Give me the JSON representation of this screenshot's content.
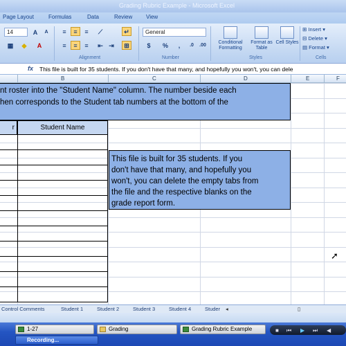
{
  "window": {
    "title": "Grading Rubric Example - Microsoft Excel"
  },
  "ribbon_tabs": [
    "Page Layout",
    "Formulas",
    "Data",
    "Review",
    "View"
  ],
  "ribbon": {
    "font_size": "14",
    "number_format": "General",
    "group_alignment": "Alignment",
    "group_number": "Number",
    "group_styles": "Styles",
    "group_cells": "Cells",
    "conditional_formatting": "Conditional Formatting",
    "format_as_table": "Format as Table",
    "cell_styles": "Cell Styles",
    "insert_label": "Insert",
    "delete_label": "Delete",
    "format_label": "Format",
    "currency": "$",
    "percent": "%",
    "comma": ","
  },
  "formula_bar": {
    "fx": "fx",
    "content": "This file is built for 35 students.  If you don't have that many, and hopefully you won't, you can dele"
  },
  "columns": [
    "B",
    "C",
    "D",
    "E",
    "F"
  ],
  "sheet": {
    "banner_lines": [
      "nt roster into the \"Student Name\" column.  The number beside each",
      "hen corresponds to the Student tab numbers at the bottom of the"
    ],
    "student_name_header": "Student Name",
    "row_header_partial": "r",
    "note_lines": [
      "This file is built for 35 students.  If you",
      "don't have that many, and hopefully you",
      "won't, you can delete the empty tabs from",
      "the file and the respective blanks on the",
      "grade report form."
    ]
  },
  "sheet_tabs": [
    "Control Comments",
    "Student 1",
    "Student 2",
    "Student 3",
    "Student 4",
    "Studer"
  ],
  "taskbar": {
    "items": [
      "1-27",
      "Grading",
      "Grading Rubric Example"
    ],
    "recording": "Recording..."
  },
  "colors": {
    "banner": "#8db0e6",
    "header_fill": "#c5d7f1",
    "taskbar": "#2455c2"
  }
}
